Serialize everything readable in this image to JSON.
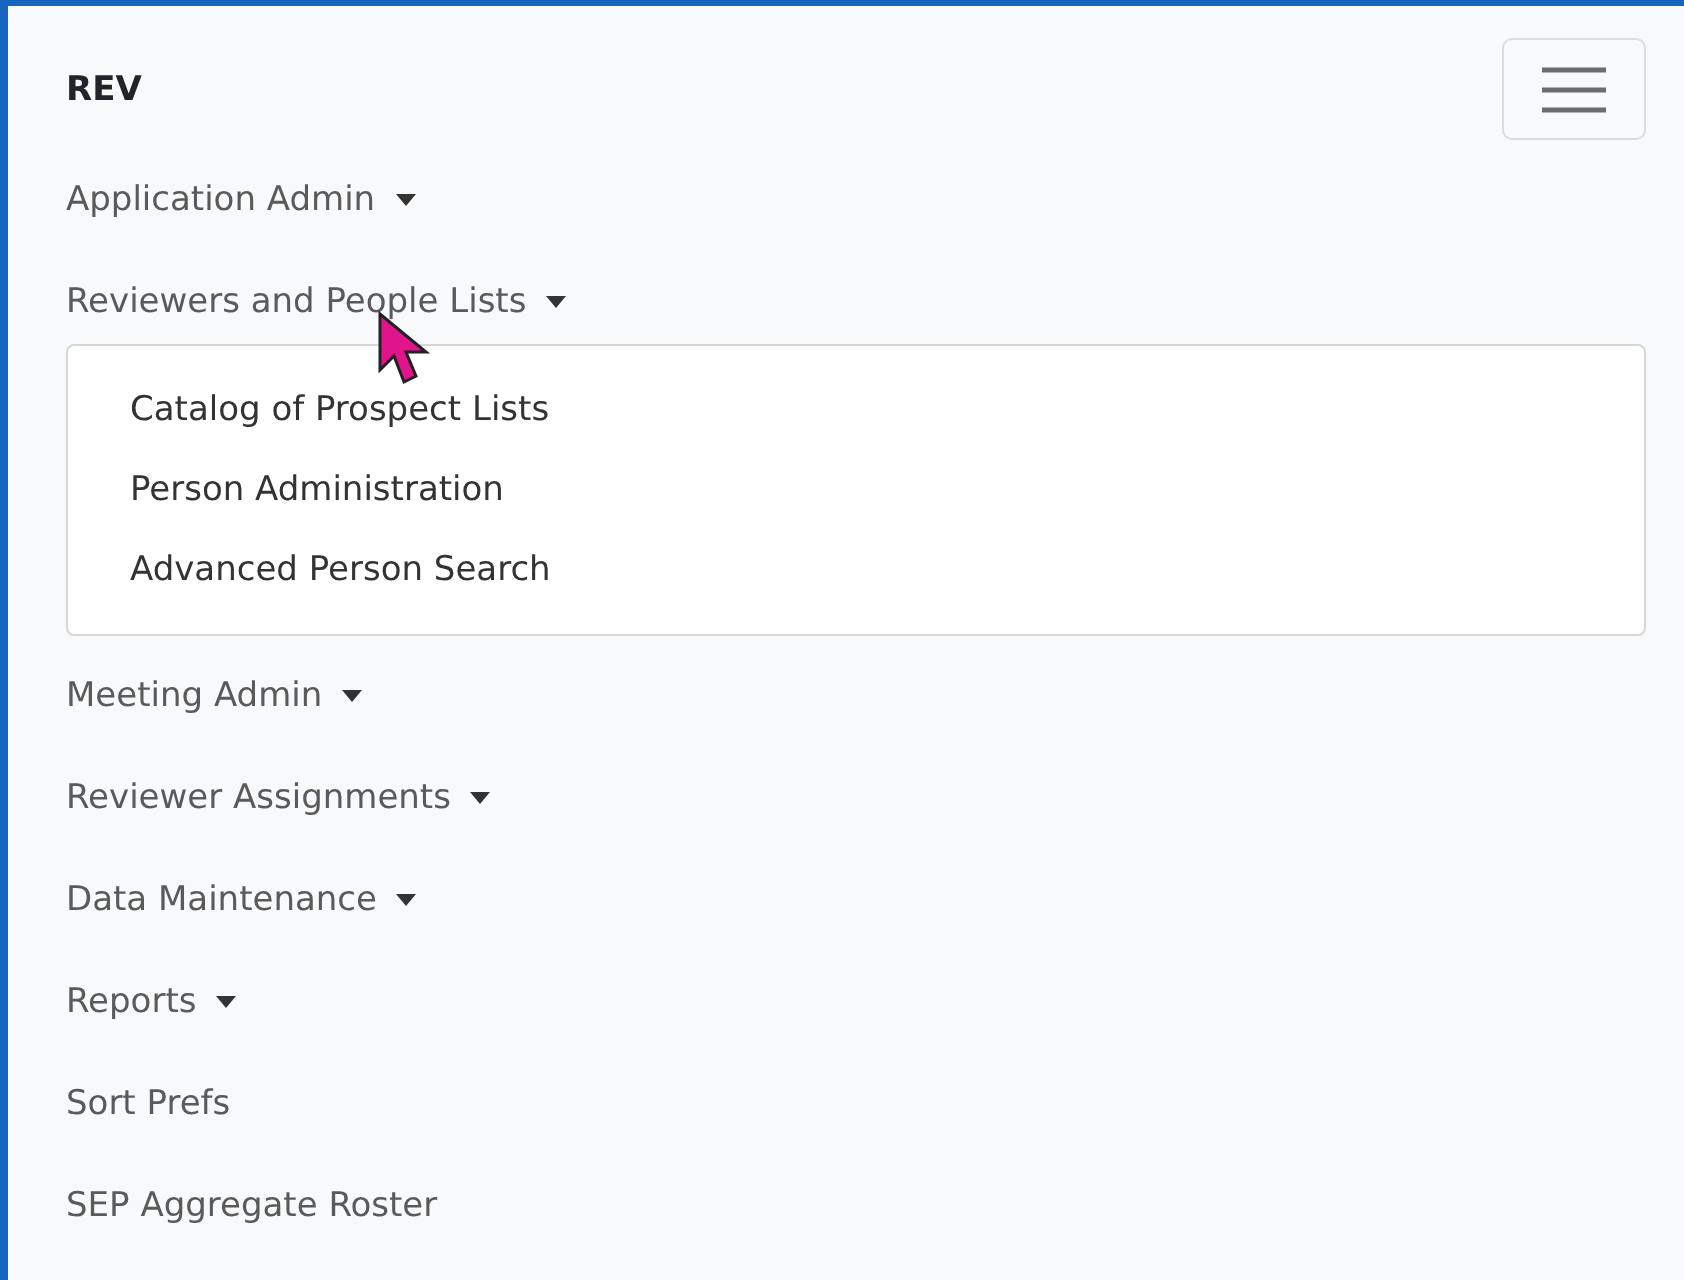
{
  "brand": "REV",
  "nav": [
    {
      "label": "Application Admin",
      "kind": "dropdown",
      "expanded": false
    },
    {
      "label": "Reviewers and People Lists",
      "kind": "dropdown",
      "expanded": true,
      "children": [
        {
          "label": "Catalog of Prospect Lists"
        },
        {
          "label": "Person Administration"
        },
        {
          "label": "Advanced Person Search"
        }
      ]
    },
    {
      "label": "Meeting Admin",
      "kind": "dropdown",
      "expanded": false
    },
    {
      "label": "Reviewer Assignments",
      "kind": "dropdown",
      "expanded": false
    },
    {
      "label": "Data Maintenance",
      "kind": "dropdown",
      "expanded": false
    },
    {
      "label": "Reports",
      "kind": "dropdown",
      "expanded": false
    },
    {
      "label": "Sort Prefs",
      "kind": "link"
    },
    {
      "label": "SEP Aggregate Roster",
      "kind": "link"
    }
  ]
}
